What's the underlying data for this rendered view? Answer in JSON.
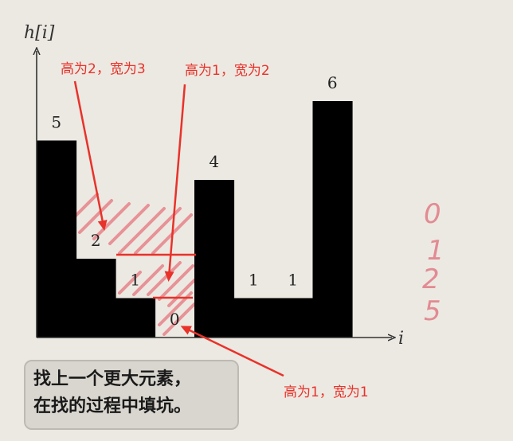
{
  "chart_data": {
    "type": "bar",
    "ylabel": "h[i]",
    "xlabel": "i",
    "values": [
      5,
      2,
      1,
      0,
      4,
      1,
      1,
      6
    ],
    "bar_labels": [
      "5",
      "2",
      "1",
      "0",
      "4",
      "1",
      "1",
      "6"
    ]
  },
  "annotations": {
    "label_a": "高为2，宽为3",
    "label_b": "高为1，宽为2",
    "label_c": "高为1，宽为1"
  },
  "handwriting": [
    "0",
    "1",
    "2",
    "5"
  ],
  "caption": {
    "line1": "找上一个更大元素，",
    "line2": "在找的过程中填坑。"
  },
  "colors": {
    "bar": "#000000",
    "annotation": "#e8322a",
    "hatch": "#e7848a",
    "handwriting": "#e28b93",
    "background": "#ece9e2"
  }
}
